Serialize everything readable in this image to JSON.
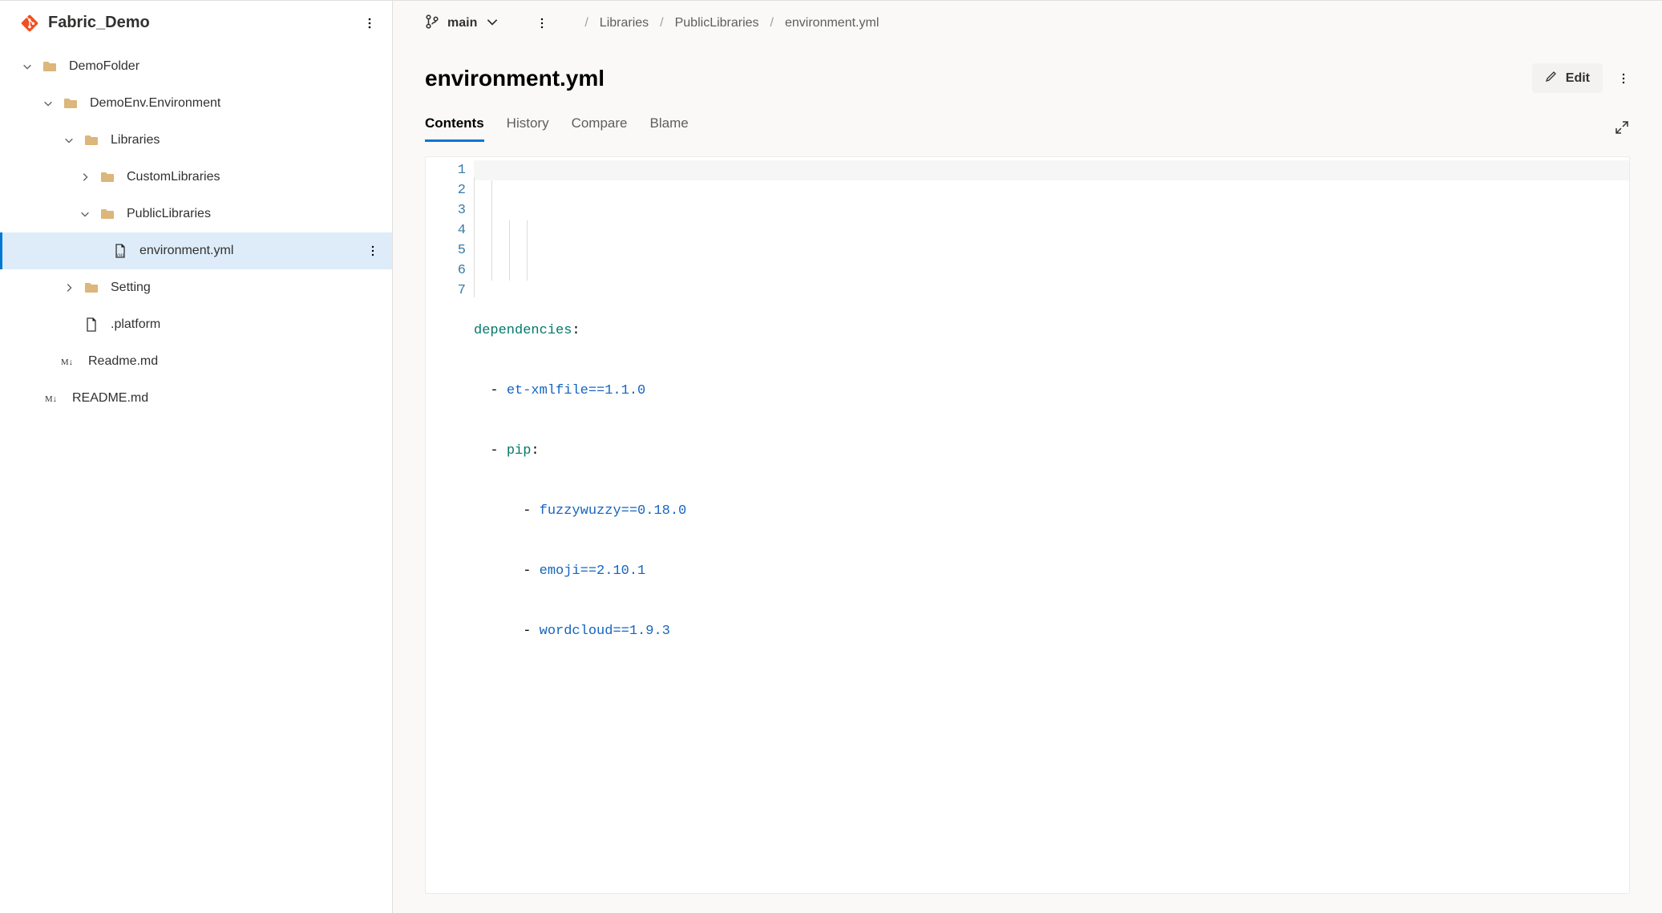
{
  "sidebar": {
    "repo_name": "Fabric_Demo",
    "tree": {
      "demo_folder": "DemoFolder",
      "demo_env": "DemoEnv.Environment",
      "libraries": "Libraries",
      "custom_libs": "CustomLibraries",
      "public_libs": "PublicLibraries",
      "env_yml": "environment.yml",
      "setting": "Setting",
      "platform": ".platform",
      "readme_inner": "Readme.md",
      "readme_root": "README.md"
    }
  },
  "branch": {
    "label": "main"
  },
  "breadcrumb": {
    "a": "Libraries",
    "b": "PublicLibraries",
    "c": "environment.yml"
  },
  "file": {
    "title": "environment.yml",
    "edit_label": "Edit"
  },
  "tabs": {
    "contents": "Contents",
    "history": "History",
    "compare": "Compare",
    "blame": "Blame"
  },
  "code": {
    "lines": [
      "1",
      "2",
      "3",
      "4",
      "5",
      "6",
      "7"
    ],
    "l1_key": "dependencies",
    "l1_colon": ":",
    "dash": "- ",
    "l2_pkg": "et-xmlfile==1.1.0",
    "l3_key": "pip",
    "l3_colon": ":",
    "l4_pkg": "fuzzywuzzy==0.18.0",
    "l5_pkg": "emoji==2.10.1",
    "l6_pkg": "wordcloud==1.9.3"
  }
}
